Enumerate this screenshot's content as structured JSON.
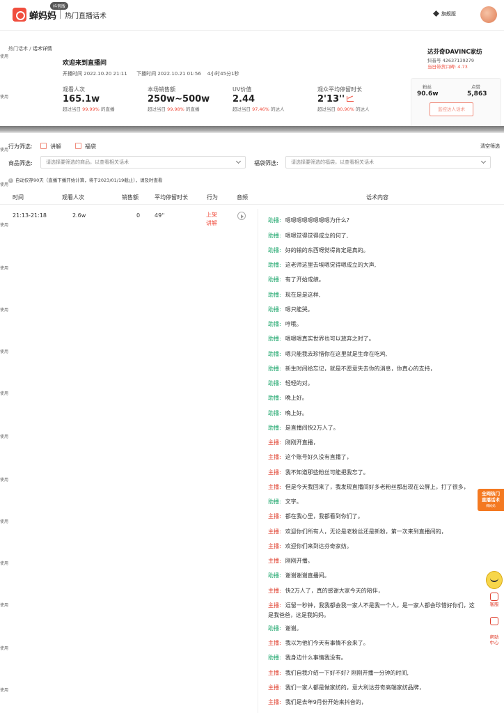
{
  "topbar": {
    "brand": "蝉妈妈",
    "badge": "抖音版",
    "subtitle": "热门直播话术",
    "version": "旗舰版"
  },
  "watermark": "使用",
  "breadcrumb": {
    "parent": "热门话术",
    "sep": " / ",
    "current": "话术详情"
  },
  "room": {
    "title": "欢迎来到直播间",
    "start_label": "开播时间",
    "start": "2022.10.20 21:11",
    "end_label": "下播时间",
    "end": "2022.10.21 01:56",
    "duration": "4小时45分1秒"
  },
  "stats": [
    {
      "label": "观看人次",
      "value": "165.1w",
      "cmp_prefix": "超过当日",
      "cmp_pct": "99.99%",
      "cmp_suffix": "的直播"
    },
    {
      "label": "本场销售额",
      "value": "250w~500w",
      "cmp_prefix": "超过当日",
      "cmp_pct": "99.98%",
      "cmp_suffix": "的直播"
    },
    {
      "label": "UV价值",
      "value": "2.44",
      "cmp_prefix": "超过当日",
      "cmp_pct": "97.46%",
      "cmp_suffix": "的达人"
    },
    {
      "label": "观众平均停留时长",
      "value": "2'13''",
      "cmp_prefix": "超过当日",
      "cmp_pct": "80.90%",
      "cmp_suffix": "的达人"
    }
  ],
  "shop": {
    "name": "达芬奇DAVINC家纺",
    "id_label": "抖音号",
    "id": "42637139279",
    "score_label": "当日带货口碑:",
    "score": "4.73",
    "fans_label": "粉丝",
    "fans": "90.6w",
    "likes_label": "点赞",
    "likes": "5,863",
    "monitor_button": "监控达人话术"
  },
  "filters": {
    "behavior_label": "行为筛选:",
    "behavior_opts": [
      "讲解",
      "福袋"
    ],
    "clear": "清空筛选",
    "goods_label": "商品筛选:",
    "goods_placeholder": "请选择要筛选的商品，以查看相关话术",
    "bag_label": "福袋筛选:",
    "bag_placeholder": "请选择要筛选的福袋，以查看相关话术",
    "note": "自动仅存90天（直播下播开始计算，将于2023/01/19截止），请及时查看"
  },
  "table": {
    "headers": [
      "时间",
      "观看人次",
      "销售额",
      "平均停留时长",
      "行为",
      "音频",
      "话术内容"
    ],
    "row": {
      "time": "21:13-21:18",
      "views": "2.6w",
      "sales": "0",
      "stay": "49''",
      "action_line1": "上架",
      "action_line2": "讲解"
    }
  },
  "transcript": [
    {
      "speaker": "助播:",
      "role": "assist",
      "text": "嗯嗯嗯嗯嗯嗯嗯嗯为什么?"
    },
    {
      "speaker": "助播:",
      "role": "assist",
      "text": "嗯嗯觉得觉得成立的何了,"
    },
    {
      "speaker": "助播:",
      "role": "assist",
      "text": "好的输的东西呀觉得肯定是真的。"
    },
    {
      "speaker": "助播:",
      "role": "assist",
      "text": "这老师这里去埃嗯觉得嗯成立的大声,"
    },
    {
      "speaker": "助播:",
      "role": "assist",
      "text": "有了开始成绩。"
    },
    {
      "speaker": "助播:",
      "role": "assist",
      "text": "现在是是这样,"
    },
    {
      "speaker": "助播:",
      "role": "assist",
      "text": "嗯只能哭。"
    },
    {
      "speaker": "助播:",
      "role": "assist",
      "text": "哼哦。"
    },
    {
      "speaker": "助播:",
      "role": "assist",
      "text": "嗯嗯嗯真实世界也可以放弃之时了。"
    },
    {
      "speaker": "助播:",
      "role": "assist",
      "text": "嗯只能我去珍惜你在这里就是生命在吃鸡,"
    },
    {
      "speaker": "助播:",
      "role": "assist",
      "text": "新生时间给忘记，就是不愿意失去你的消息，你真心的支持，"
    },
    {
      "speaker": "助播:",
      "role": "assist",
      "text": "轻轻的对。"
    },
    {
      "speaker": "助播:",
      "role": "assist",
      "text": "晚上好。"
    },
    {
      "speaker": "助播:",
      "role": "assist",
      "text": "晚上好。"
    },
    {
      "speaker": "助播:",
      "role": "assist",
      "text": "是直播间快2万人了。"
    },
    {
      "speaker": "主播:",
      "role": "host",
      "text": "刚刚开直播，"
    },
    {
      "speaker": "主播:",
      "role": "host",
      "text": "这个账号好久没有直播了，"
    },
    {
      "speaker": "主播:",
      "role": "host",
      "text": "我不知道那些粉丝可能把我忘了。"
    },
    {
      "speaker": "主播:",
      "role": "host",
      "text": "但是今天我回来了，我发现直播间好多老粉丝都出现在公屏上，打了很多，"
    },
    {
      "speaker": "助播:",
      "role": "assist",
      "text": "文字。"
    },
    {
      "speaker": "主播:",
      "role": "host",
      "text": "都在我心里，我都看到你们了。"
    },
    {
      "speaker": "主播:",
      "role": "host",
      "text": "欢迎你们所有人，无论是老粉丝还是新粉，第一次来到直播间的，"
    },
    {
      "speaker": "主播:",
      "role": "host",
      "text": "欢迎你们来到达芬奇家纺。"
    },
    {
      "speaker": "主播:",
      "role": "host",
      "text": "刚刚开播。"
    },
    {
      "speaker": "助播:",
      "role": "assist",
      "text": "谢谢谢谢直播间。"
    },
    {
      "speaker": "主播:",
      "role": "host",
      "text": "快2万人了，真的感谢大家今天的陪伴，"
    },
    {
      "speaker": "主播:",
      "role": "host",
      "text": "逗留一秒钟，我我都会我一家人不是我一个人，是一家人都会珍惜好你们，这"
    },
    {
      "speaker": "",
      "role": "host",
      "text": "是我爸爸，这是我妈妈。"
    },
    {
      "speaker": "助播:",
      "role": "assist",
      "text": "谢谢。"
    },
    {
      "speaker": "主播:",
      "role": "host",
      "text": "我以为他们今天有事情不会来了。"
    },
    {
      "speaker": "助播:",
      "role": "assist",
      "text": "我身边什么事情我没有。"
    },
    {
      "speaker": "主播:",
      "role": "host",
      "text": "我们自我介绍一下好不好? 刚刚开播一分钟的时间,"
    },
    {
      "speaker": "主播:",
      "role": "host",
      "text": "我们一家人都是做家纺的，意大利达芬奇高端家纺品牌，"
    },
    {
      "speaker": "主播:",
      "role": "host",
      "text": "我们是去年9月份开始来抖音的，"
    }
  ],
  "float": {
    "rank_line1": "全网热门",
    "rank_line2": "直播话术",
    "rank_small": "蝉妈妈",
    "service": "客服",
    "help_line1": "帮助",
    "help_line2": "中心"
  }
}
